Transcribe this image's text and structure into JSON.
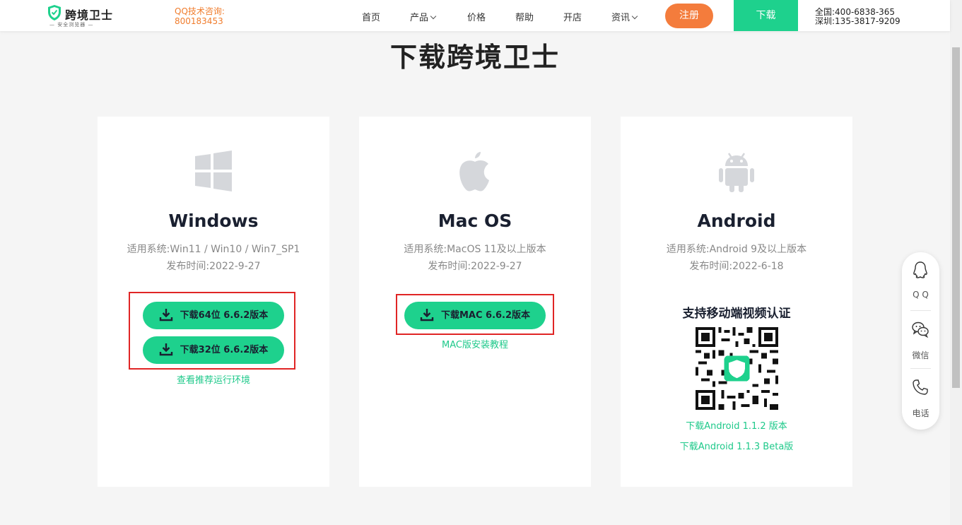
{
  "header": {
    "logo_name": "跨境卫士",
    "logo_slogan": "— 安全浏览器 —",
    "qq_label": "QQ技术咨询:",
    "qq_number": "800183453",
    "nav": [
      {
        "label": "首页"
      },
      {
        "label": "产品"
      },
      {
        "label": "价格"
      },
      {
        "label": "帮助"
      },
      {
        "label": "开店"
      },
      {
        "label": "资讯"
      }
    ],
    "register_label": "注册",
    "download_label": "下载",
    "phone_national": "全国:400-6838-365",
    "phone_shenzhen": "深圳:135-3817-9209"
  },
  "page_title": "下载跨境卫士",
  "cards": {
    "windows": {
      "title": "Windows",
      "systems": "适用系统:Win11 / Win10 / Win7_SP1",
      "release": "发布时间:2022-9-27",
      "btn_64": "下载64位 6.6.2版本",
      "btn_32": "下载32位 6.6.2版本",
      "link": "查看推荐运行环境"
    },
    "mac": {
      "title": "Mac OS",
      "systems": "适用系统:MacOS 11及以上版本",
      "release": "发布时间:2022-9-27",
      "btn": "下载MAC 6.6.2版本",
      "link": "MAC版安装教程"
    },
    "android": {
      "title": "Android",
      "systems": "适用系统:Android 9及以上版本",
      "release": "发布时间:2022-6-18",
      "mobile_title": "支持移动端视频认证",
      "link_1": "下载Android 1.1.2 版本",
      "link_2": "下载Android 1.1.3 Beta版"
    }
  },
  "float_bar": {
    "qq_label": "Q Q",
    "wechat_label": "微信",
    "phone_label": "电话"
  },
  "colors": {
    "brand_green": "#1ed18d",
    "accent_orange": "#f47c3c",
    "highlight_red": "#e02525"
  }
}
